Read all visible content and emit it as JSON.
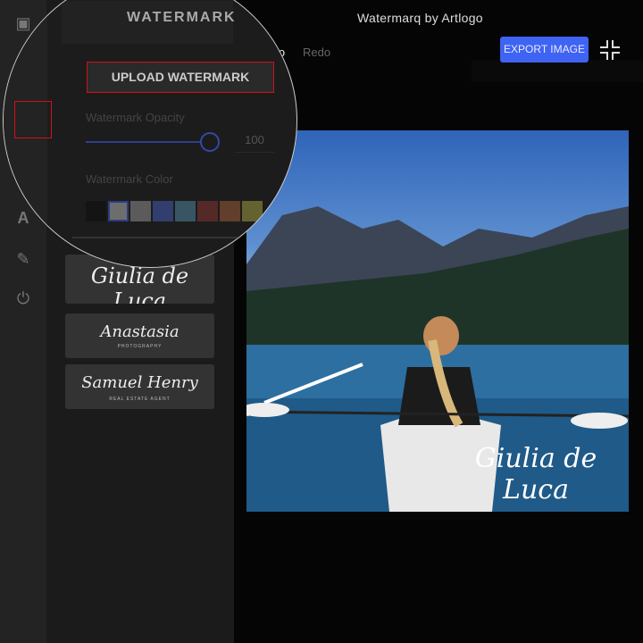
{
  "app": {
    "title": "Watermarq by Artlogo"
  },
  "toolbar": {
    "undo_label": "Undo",
    "redo_label": "Redo",
    "export_label": "EXPORT IMAGE",
    "exit_icon": "minimize-icon",
    "accent": "#3f63f3"
  },
  "sidebar": {
    "items": [
      {
        "icon": "image-icon"
      },
      {
        "icon": "crop-icon"
      },
      {
        "icon": "watermark-icon",
        "active": true
      },
      {
        "icon": "adjust-icon"
      },
      {
        "icon": "text-icon"
      },
      {
        "icon": "brush-icon"
      },
      {
        "icon": "effects-icon"
      }
    ]
  },
  "panel": {
    "heading": "WATERMARK",
    "upload_label": "UPLOAD WATERMARK",
    "opacity_label": "Watermark Opacity",
    "opacity_value": "100",
    "color_label": "Watermark Color",
    "colors": [
      "#111111",
      "#888888",
      "#707070",
      "#3a4a8a",
      "#40687a",
      "#6a2e2e",
      "#7a4a32",
      "#7d7a38"
    ],
    "selected_color": "#888888",
    "signatures": [
      {
        "name": "Giulia de Luca",
        "sub": ""
      },
      {
        "name": "Anastasia",
        "sub": "PHOTOGRAPHY"
      },
      {
        "name": "Samuel Henry",
        "sub": "REAL ESTATE AGENT"
      }
    ]
  },
  "canvas": {
    "watermark_text": "Giulia de Luca"
  }
}
